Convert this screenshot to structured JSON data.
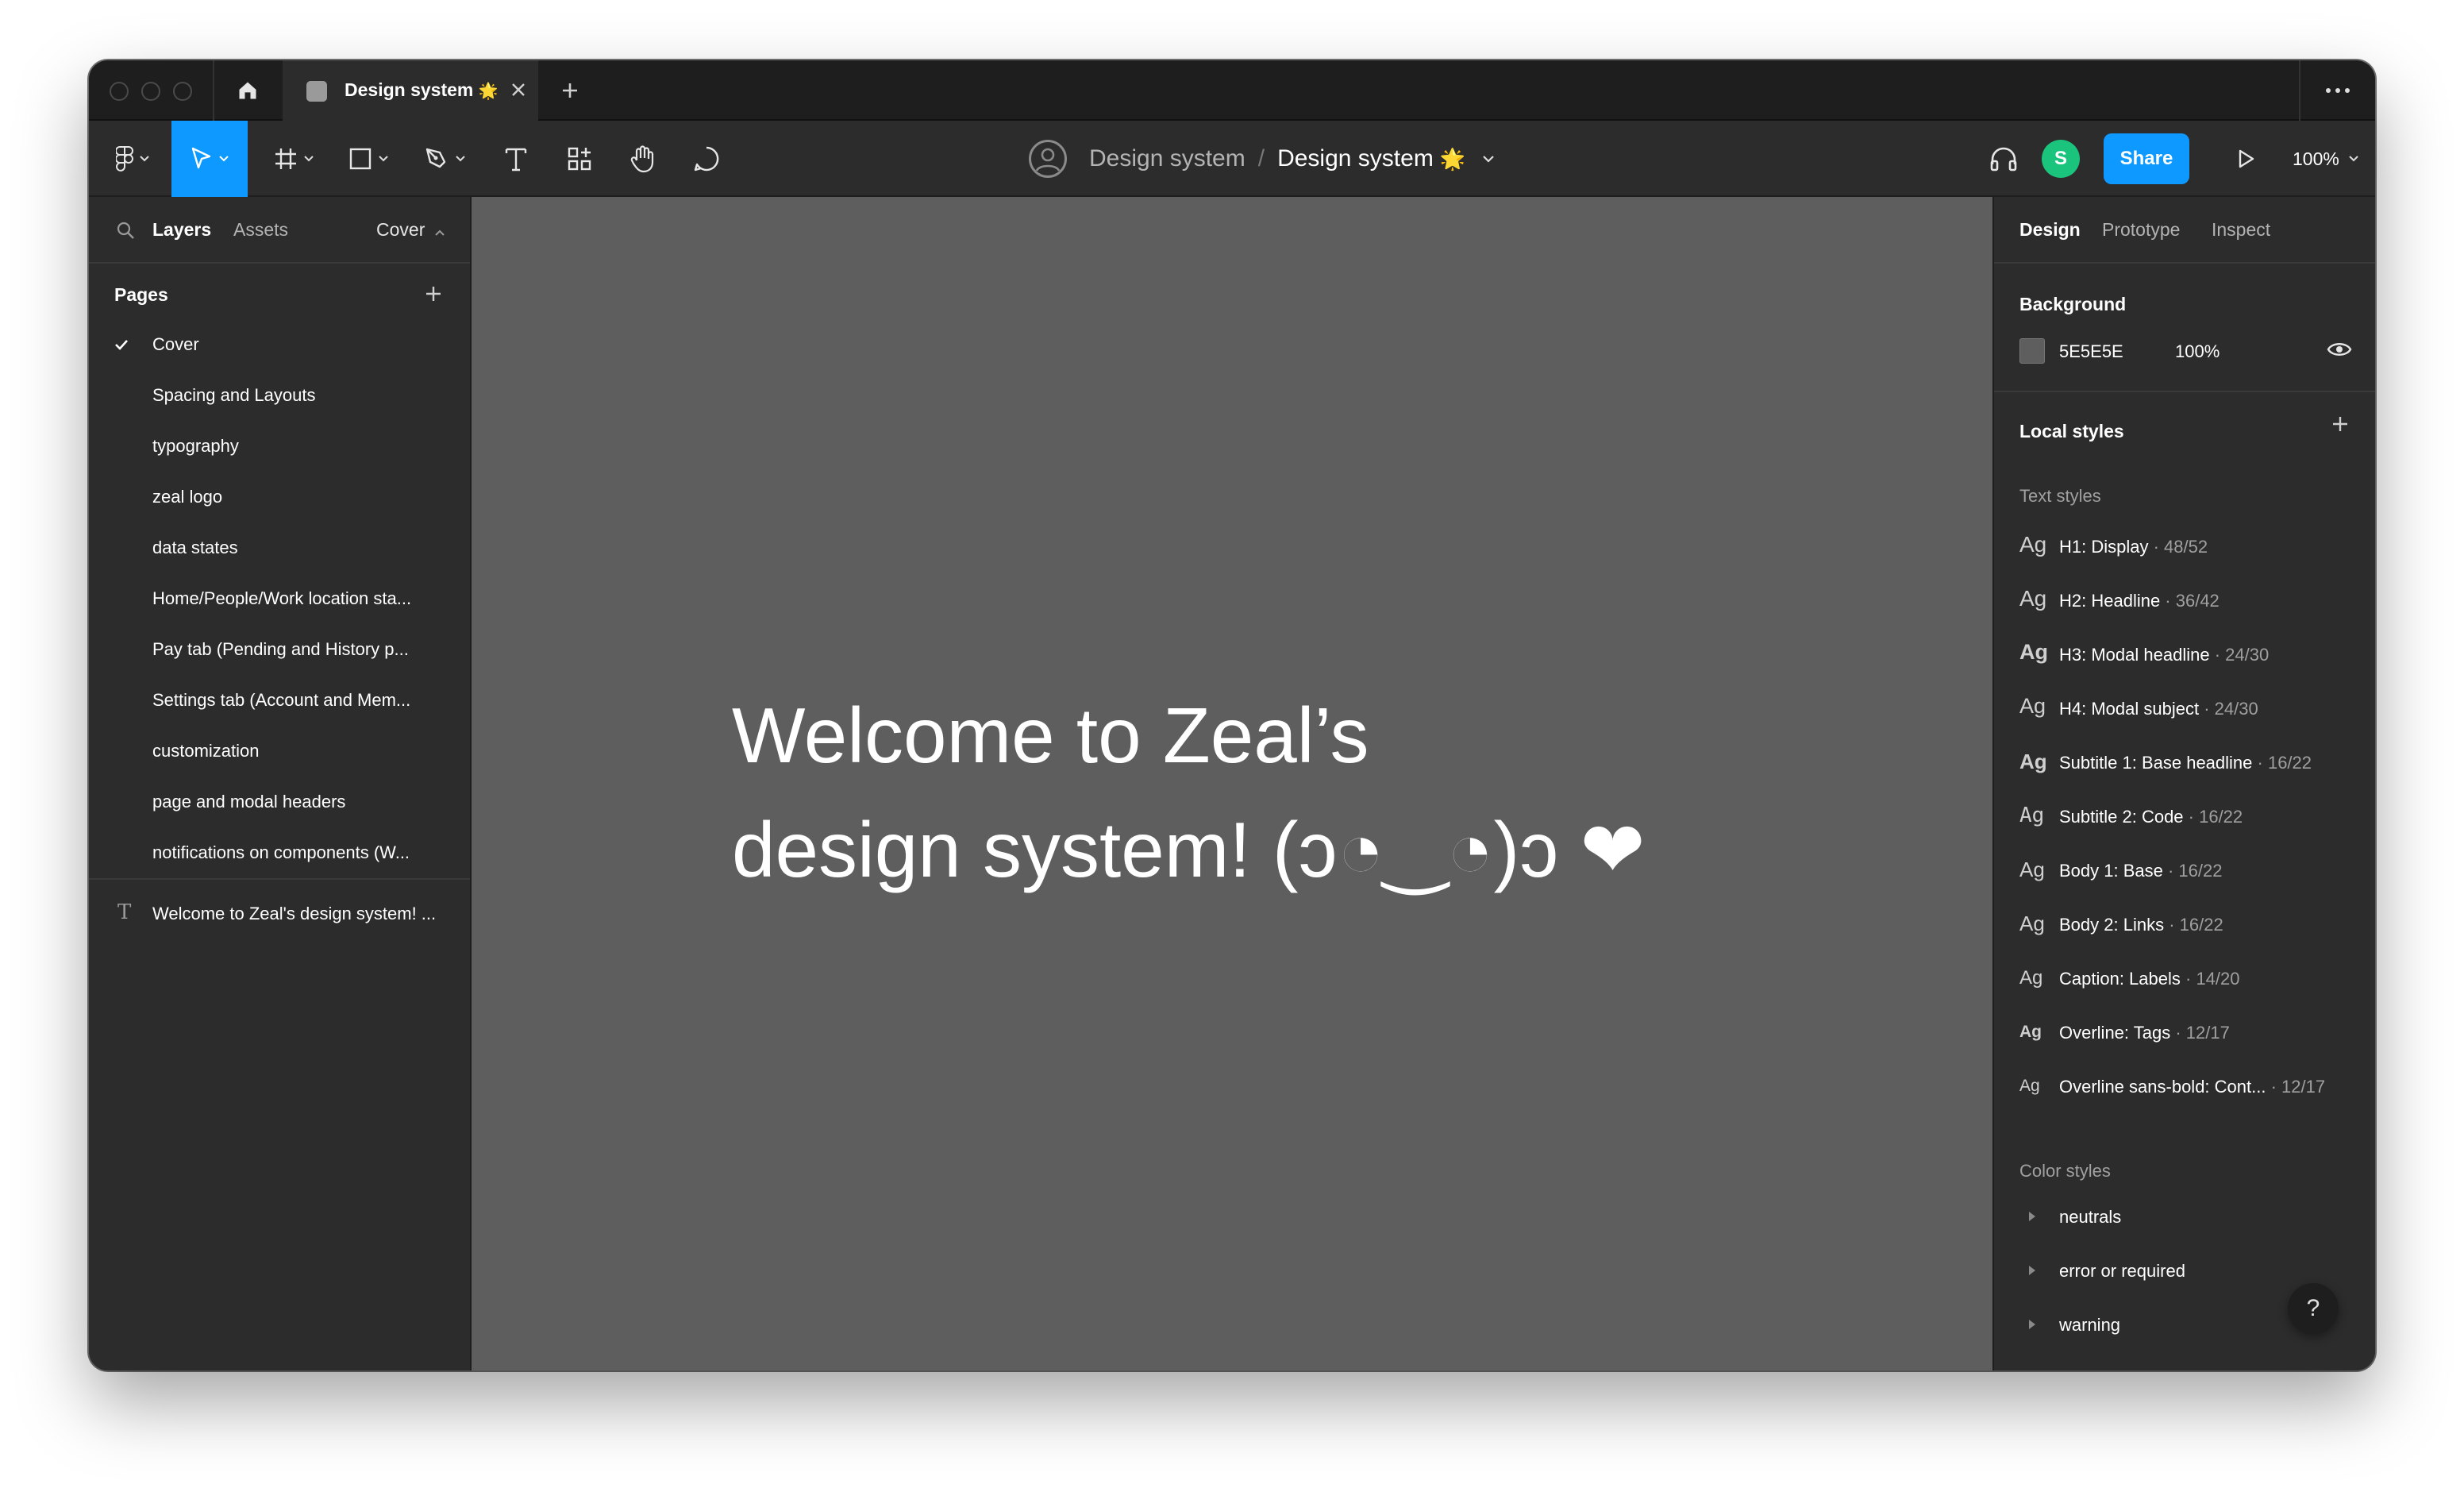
{
  "tab": {
    "title": "Design system",
    "emoji": "🌟"
  },
  "breadcrumb": {
    "team": "Design system",
    "separator": "/",
    "file": "Design system",
    "emoji": "🌟"
  },
  "user": {
    "initial": "S",
    "color": "#1bc47d"
  },
  "toolbar": {
    "share_label": "Share",
    "zoom": "100%"
  },
  "left_panel": {
    "tabs": [
      "Layers",
      "Assets"
    ],
    "current_page": "Cover",
    "pages_title": "Pages",
    "pages": [
      "Cover",
      "Spacing and Layouts",
      "typography",
      "zeal logo",
      "data states",
      "Home/People/Work location sta...",
      "Pay tab (Pending and History p...",
      "Settings tab (Account and Mem...",
      "customization",
      "page and modal headers",
      "notifications on components (W..."
    ],
    "layers": [
      "Welcome to Zeal's design system! ..."
    ]
  },
  "canvas": {
    "background": "#5E5E5E",
    "line1": "Welcome to Zeal’s",
    "line2": "design system! (ɔ◔‿◔)ɔ ❤"
  },
  "right_panel": {
    "tabs": [
      "Design",
      "Prototype",
      "Inspect"
    ],
    "background_title": "Background",
    "background_hex": "5E5E5E",
    "background_opacity": "100%",
    "local_styles_title": "Local styles",
    "text_styles_title": "Text styles",
    "text_styles": [
      {
        "ag": "Ag",
        "name": "H1: Display",
        "spec": " · 48/52"
      },
      {
        "ag": "Ag",
        "name": "H2: Headline",
        "spec": " · 36/42"
      },
      {
        "ag": "Ag",
        "name": "H3: Modal headline",
        "spec": " · 24/30"
      },
      {
        "ag": "Ag",
        "name": "H4: Modal subject",
        "spec": " · 24/30"
      },
      {
        "ag": "Ag",
        "name": "Subtitle 1: Base headline",
        "spec": " · 16/22"
      },
      {
        "ag": "Ag",
        "name": "Subtitle 2: Code",
        "spec": " · 16/22"
      },
      {
        "ag": "Ag",
        "name": "Body 1: Base",
        "spec": " · 16/22"
      },
      {
        "ag": "Ag",
        "name": "Body 2: Links",
        "spec": " · 16/22"
      },
      {
        "ag": "Ag",
        "name": "Caption: Labels",
        "spec": " · 14/20"
      },
      {
        "ag": "Ag",
        "name": "Overline: Tags",
        "spec": " · 12/17"
      },
      {
        "ag": "Ag",
        "name": "Overline sans-bold: Cont...",
        "spec": " · 12/17"
      }
    ],
    "color_styles_title": "Color styles",
    "color_styles": [
      "neutrals",
      "error or required",
      "warning"
    ]
  },
  "help": "?",
  "colors": {
    "accent": "#0d99ff",
    "panel": "#2c2c2c",
    "titlebar": "#1e1e1e",
    "canvas": "#5e5e5e"
  }
}
